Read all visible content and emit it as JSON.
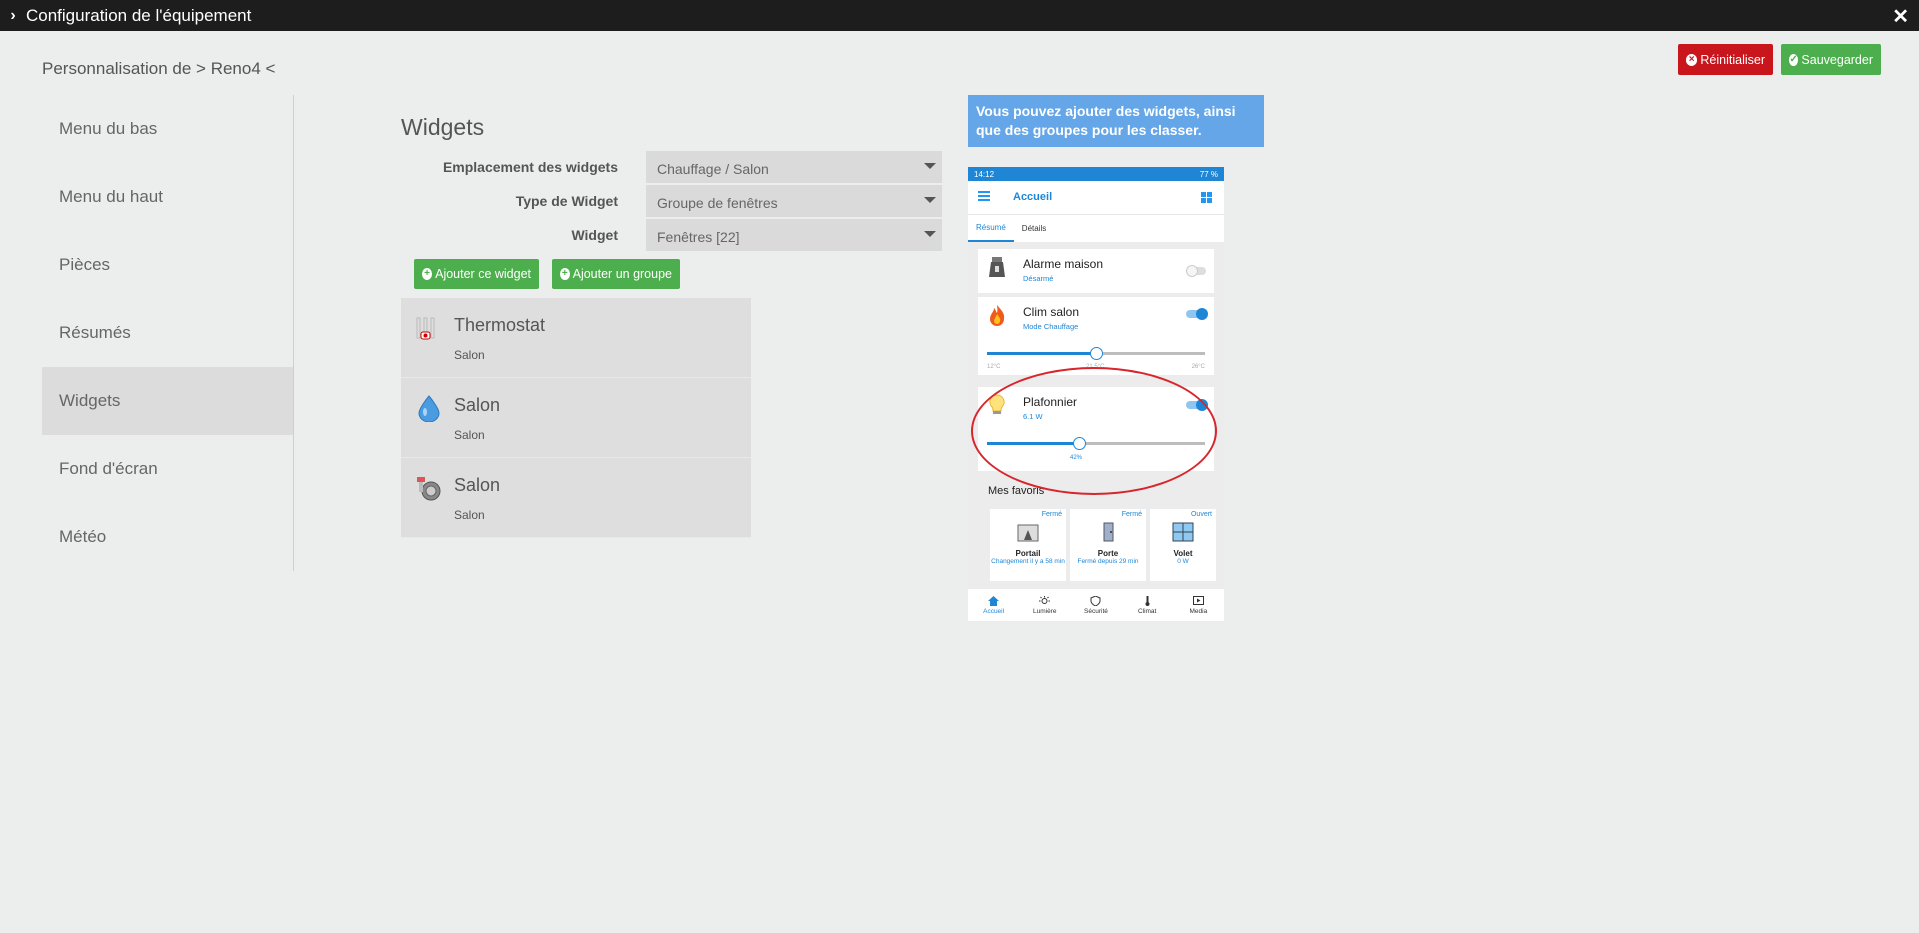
{
  "window": {
    "title": "Configuration de l'équipement"
  },
  "header": {
    "heading": "Personnalisation de > Reno4 <",
    "reset_label": "Réinitialiser",
    "save_label": "Sauvegarder"
  },
  "sidebar": {
    "items": [
      {
        "label": "Menu du bas"
      },
      {
        "label": "Menu du haut"
      },
      {
        "label": "Pièces"
      },
      {
        "label": "Résumés"
      },
      {
        "label": "Widgets"
      },
      {
        "label": "Fond d'écran"
      },
      {
        "label": "Météo"
      }
    ],
    "active": "Widgets"
  },
  "main": {
    "title": "Widgets",
    "form": {
      "location": {
        "label": "Emplacement des widgets",
        "value": "Chauffage / Salon"
      },
      "type": {
        "label": "Type de Widget",
        "value": "Groupe de fenêtres"
      },
      "widget": {
        "label": "Widget",
        "value": "Fenêtres [22]"
      }
    },
    "add_widget_label": "Ajouter ce widget",
    "add_group_label": "Ajouter un groupe",
    "widgets": [
      {
        "name": "Thermostat",
        "room": "Salon",
        "icon": "thermometer-icon"
      },
      {
        "name": "Salon",
        "room": "Salon",
        "icon": "water-drop-icon"
      },
      {
        "name": "Salon",
        "room": "Salon",
        "icon": "valve-icon"
      }
    ]
  },
  "info": {
    "text": "Vous pouvez ajouter des widgets, ainsi que des groupes pour les classer."
  },
  "phone": {
    "status_time": "14:12",
    "status_right": "77 %",
    "app_title": "Accueil",
    "tabs": [
      "Résumé",
      "Détails"
    ],
    "cards": {
      "alarm": {
        "name": "Alarme maison",
        "status": "Désarmé"
      },
      "clim": {
        "name": "Clim salon",
        "status": "Mode Chauffage",
        "min": "12°C",
        "mid": "21.5°C",
        "max": "26°C",
        "level": 0.5
      },
      "plafonnier": {
        "name": "Plafonnier",
        "status": "6.1 W",
        "value": "42%",
        "level": 0.42
      }
    },
    "favorites_title": "Mes favoris",
    "favorites": [
      {
        "state": "Fermé",
        "name": "Portail",
        "detail": "Changement il y a 58 min"
      },
      {
        "state": "Fermé",
        "name": "Porte",
        "detail": "Fermé depuis 29 min"
      },
      {
        "state": "Ouvert",
        "name": "Volet",
        "detail": "0 W"
      }
    ],
    "nav": [
      "Accueil",
      "Lumière",
      "Sécurité",
      "Climat",
      "Media"
    ]
  },
  "colors": {
    "accent": "#1f86d6",
    "danger": "#c8161c",
    "success": "#4cae4c",
    "info": "#64a6e8",
    "highlight": "#d8262d"
  }
}
